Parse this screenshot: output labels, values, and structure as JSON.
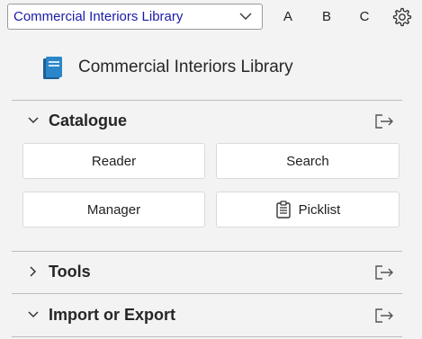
{
  "top": {
    "library_select": "Commercial Interiors Library",
    "letters": [
      "A",
      "B",
      "C"
    ]
  },
  "header": {
    "title": "Commercial Interiors Library"
  },
  "sections": {
    "catalogue": {
      "label": "Catalogue",
      "expanded": true,
      "buttons": {
        "reader": "Reader",
        "search": "Search",
        "manager": "Manager",
        "picklist": "Picklist"
      }
    },
    "tools": {
      "label": "Tools",
      "expanded": false
    },
    "import_export": {
      "label": "Import or Export",
      "expanded": true
    }
  },
  "colors": {
    "select_text": "#1a1aa8",
    "book_icon": "#1f6fb2"
  },
  "icons": [
    "chevron-down-icon",
    "gear-icon",
    "book-icon",
    "chevron-right-icon",
    "export-icon",
    "clipboard-icon"
  ]
}
